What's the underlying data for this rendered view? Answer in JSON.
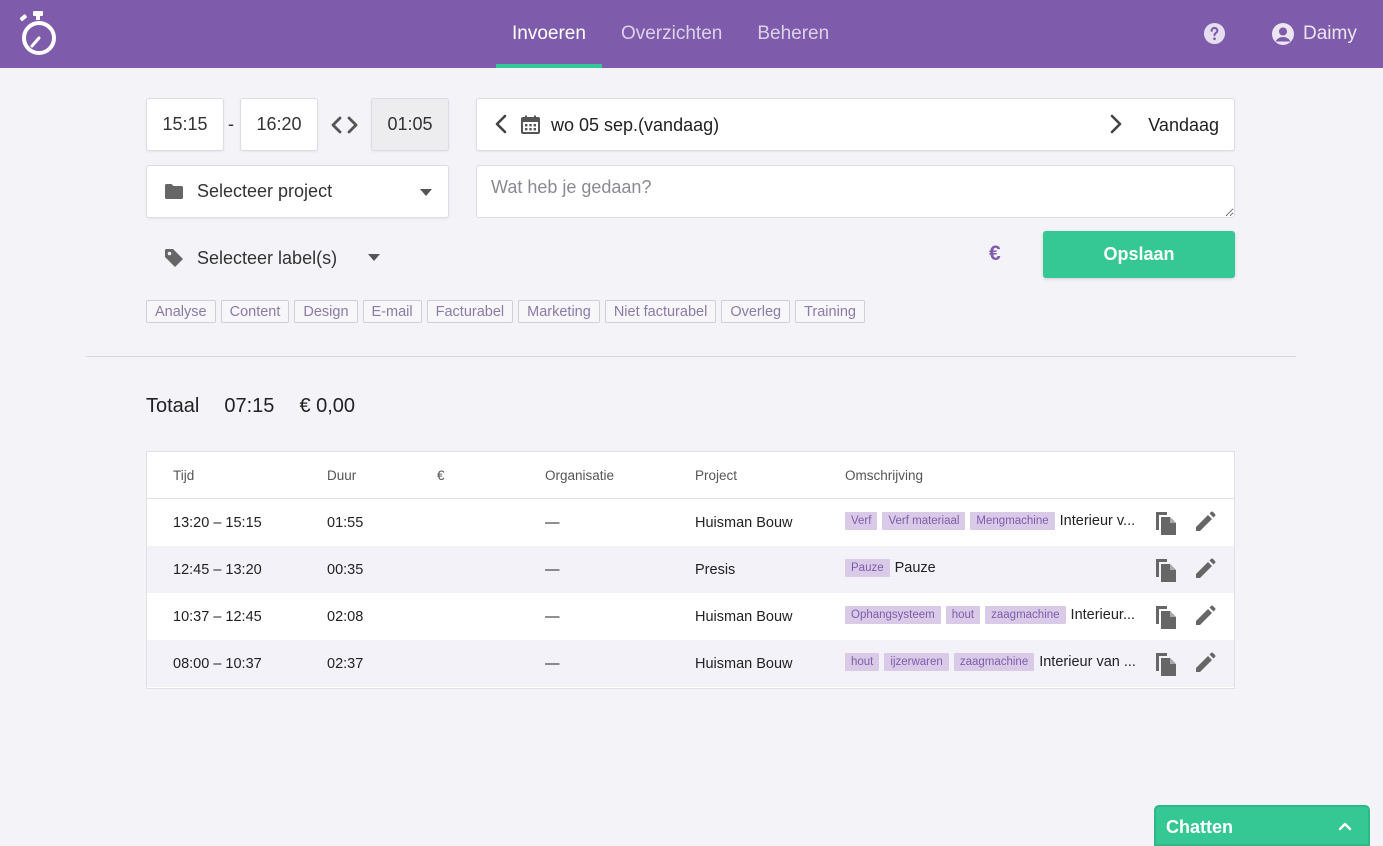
{
  "header": {
    "nav": [
      {
        "label": "Invoeren",
        "active": true
      },
      {
        "label": "Overzichten",
        "active": false
      },
      {
        "label": "Beheren",
        "active": false
      }
    ],
    "user_name": "Daimy",
    "accent": "#7f5bab",
    "highlight": "#35c794"
  },
  "form": {
    "start_time": "15:15",
    "separator": "-",
    "end_time": "16:20",
    "duration": "01:05",
    "date": "wo 05 sep.(vandaag)",
    "today_label": "Vandaag",
    "project_placeholder": "Selecteer project",
    "description_placeholder": "Wat heb je gedaan?",
    "label_placeholder": "Selecteer label(s)",
    "currency_symbol": "€",
    "save_label": "Opslaan",
    "label_chips": [
      "Analyse",
      "Content",
      "Design",
      "E-mail",
      "Facturabel",
      "Marketing",
      "Niet facturabel",
      "Overleg",
      "Training"
    ]
  },
  "totals": {
    "label": "Totaal",
    "time": "07:15",
    "amount": "€ 0,00"
  },
  "table": {
    "headers": {
      "time": "Tijd",
      "duration": "Duur",
      "amount": "€",
      "organization": "Organisatie",
      "project": "Project",
      "description": "Omschrijving"
    },
    "rows": [
      {
        "time": "13:20 – 15:15",
        "duration": "01:55",
        "amount": "",
        "organization": "—",
        "project": "Huisman Bouw",
        "tags": [
          "Verf",
          "Verf materiaal",
          "Mengmachine"
        ],
        "description": "Interieur v..."
      },
      {
        "time": "12:45 – 13:20",
        "duration": "00:35",
        "amount": "",
        "organization": "—",
        "project": "Presis",
        "tags": [
          "Pauze"
        ],
        "description": "Pauze"
      },
      {
        "time": "10:37 – 12:45",
        "duration": "02:08",
        "amount": "",
        "organization": "—",
        "project": "Huisman Bouw",
        "tags": [
          "Ophangsysteem",
          "hout",
          "zaagmachine"
        ],
        "description": "Interieur..."
      },
      {
        "time": "08:00 – 10:37",
        "duration": "02:37",
        "amount": "",
        "organization": "—",
        "project": "Huisman Bouw",
        "tags": [
          "hout",
          "ijzerwaren",
          "zaagmachine"
        ],
        "description": "Interieur van ..."
      }
    ]
  },
  "chat": {
    "label": "Chatten"
  },
  "icons": {
    "logo": "stopwatch-logo-icon",
    "help": "help-icon",
    "user": "user-icon",
    "swap": "swap-icon",
    "calendar": "calendar-icon",
    "folder": "folder-icon",
    "tag": "tag-icon",
    "copy": "copy-icon",
    "edit": "edit-icon"
  }
}
